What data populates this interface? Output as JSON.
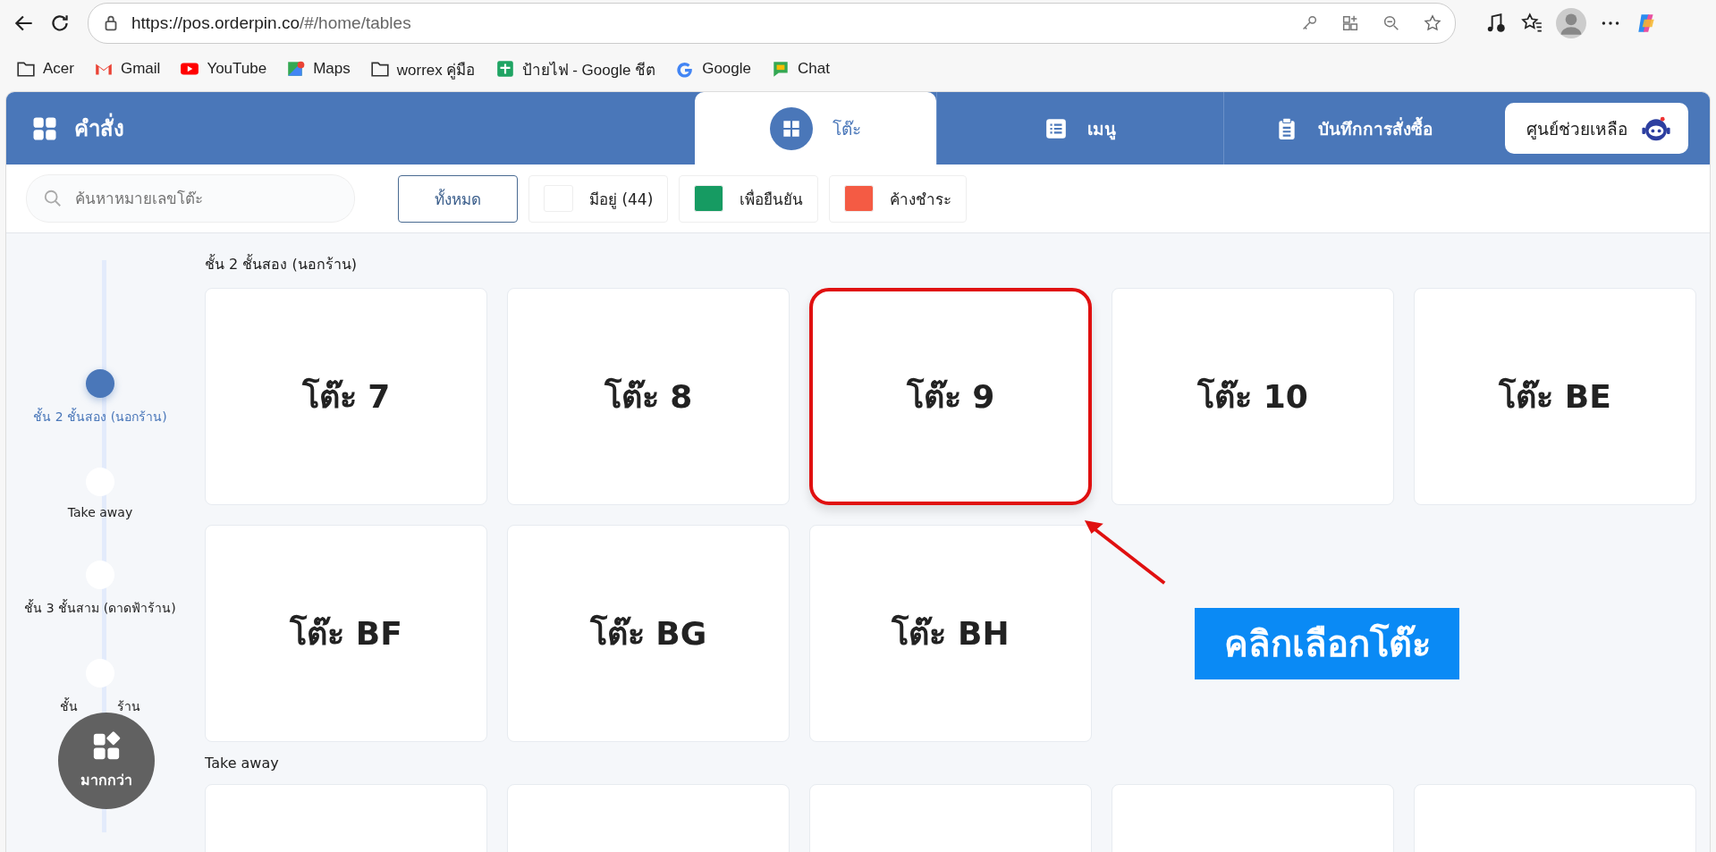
{
  "browser": {
    "url_host": "https://pos.orderpin.co",
    "url_path": "/#/home/tables",
    "bookmarks": [
      {
        "label": "Acer"
      },
      {
        "label": "Gmail"
      },
      {
        "label": "YouTube"
      },
      {
        "label": "Maps"
      },
      {
        "label": "worrex คู่มือ"
      },
      {
        "label": "ป้ายไฟ - Google ชีต"
      },
      {
        "label": "Google"
      },
      {
        "label": "Chat"
      }
    ]
  },
  "app": {
    "title": "คำสั่ง",
    "tabs": [
      {
        "label": "โต๊ะ",
        "selected": true
      },
      {
        "label": "เมนู",
        "selected": false
      },
      {
        "label": "บันทึกการสั่งซื้อ",
        "selected": false
      }
    ],
    "help_button": "ศูนย์ช่วยเหลือ"
  },
  "filters": {
    "search": {
      "placeholder": "ค้นหาหมายเลขโต๊ะ"
    },
    "buttons": [
      {
        "kind": "all",
        "label": "ทั้งหมด"
      },
      {
        "kind": "status",
        "label": "มีอยู่ (44)",
        "color": "#ffffff"
      },
      {
        "kind": "status",
        "label": "เพื่อยืนยัน",
        "color": "#169b62"
      },
      {
        "kind": "status",
        "label": "ค้างชำระ",
        "color": "#f45b44"
      }
    ]
  },
  "sidebar": {
    "items": [
      {
        "label": "ชั้น 2 ชั้นสอง (นอกร้าน)",
        "selected": true
      },
      {
        "label": "Take away",
        "selected": false
      },
      {
        "label": "ชั้น 3 ชั้นสาม (ดาดฟ้าร้าน)",
        "selected": false
      },
      {
        "label_fragments": [
          "ชั้น",
          "ร้าน"
        ],
        "selected": false
      }
    ],
    "more_button": "มากกว่า"
  },
  "sections": [
    {
      "title": "ชั้น 2 ชั้นสอง (นอกร้าน)",
      "tables": [
        {
          "name": "โต๊ะ 7",
          "highlighted": false
        },
        {
          "name": "โต๊ะ 8",
          "highlighted": false
        },
        {
          "name": "โต๊ะ 9",
          "highlighted": true
        },
        {
          "name": "โต๊ะ 10",
          "highlighted": false
        },
        {
          "name": "โต๊ะ BE",
          "highlighted": false
        },
        {
          "name": "โต๊ะ BF",
          "highlighted": false
        },
        {
          "name": "โต๊ะ BG",
          "highlighted": false
        },
        {
          "name": "โต๊ะ BH",
          "highlighted": false
        }
      ]
    },
    {
      "title": "Take away",
      "cards_cut_off": true
    }
  ],
  "annotation": {
    "callout": "คลิกเลือกโต๊ะ"
  }
}
